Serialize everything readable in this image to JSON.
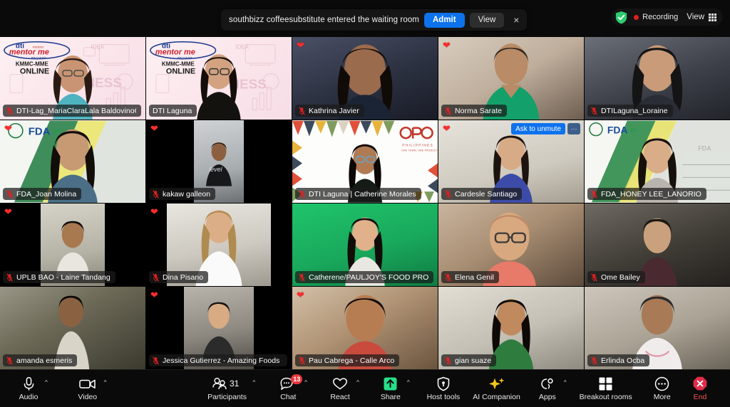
{
  "app": {
    "name": "Zoom Meeting",
    "view_mode": "Gallery View"
  },
  "top_bar": {
    "waiting_room_toast": {
      "message": "southbizz coffeesubstitute entered the waiting room",
      "admit_label": "Admit",
      "view_label": "View",
      "close_label": "×",
      "admit_color": "#0e72ed"
    },
    "encryption_icon": "shield-check-icon",
    "recording": {
      "label": "Recording",
      "dot_color": "#e02020",
      "active": true
    },
    "view_button": {
      "label": "View",
      "icon": "grid-icon"
    }
  },
  "gallery": {
    "columns": 5,
    "rows": 4,
    "active_speaker_color": "#26d07c",
    "reaction_emoji": "❤",
    "tiles": [
      {
        "name": "DTI-Lag_MariaClaraLala BaldovinoConopio",
        "muted": true,
        "reaction": false,
        "active": false,
        "bg": "dti-mentor-me"
      },
      {
        "name": "DTI Laguna",
        "muted": true,
        "reaction": false,
        "active": true,
        "bg": "dti-mentor-me"
      },
      {
        "name": "Kathrina Javier",
        "muted": true,
        "reaction": true,
        "active": false,
        "bg": "room-dark"
      },
      {
        "name": "Norma Sarate",
        "muted": true,
        "reaction": true,
        "active": false,
        "bg": "room-warm"
      },
      {
        "name": "DTILaguna_Loraine",
        "muted": true,
        "reaction": false,
        "active": false,
        "bg": "room-dim"
      },
      {
        "name": "FDA_Joan Molina",
        "muted": true,
        "reaction": true,
        "active": false,
        "bg": "fda-green"
      },
      {
        "name": "kakaw galleon",
        "muted": true,
        "reaction": true,
        "active": false,
        "bg": "black-letterbox"
      },
      {
        "name": "DTI Laguna | Catherine Morales",
        "muted": true,
        "reaction": false,
        "active": false,
        "bg": "otop-philippines"
      },
      {
        "name": "Cardesle Santiago",
        "muted": true,
        "reaction": true,
        "active": false,
        "bg": "room-plain",
        "ask_to_unmute": true
      },
      {
        "name": "FDA_HONEY LEE_LANORIO",
        "muted": true,
        "reaction": false,
        "active": false,
        "bg": "fda-green"
      },
      {
        "name": "UPLB BAO - Laine Tandang",
        "muted": true,
        "reaction": true,
        "active": false,
        "bg": "black-letterbox"
      },
      {
        "name": "Dina Pisano",
        "muted": true,
        "reaction": true,
        "active": false,
        "bg": "black-letterbox"
      },
      {
        "name": "Catherene/PAULJOY'S FOOD PRODUCTS",
        "muted": true,
        "reaction": false,
        "active": false,
        "bg": "green-screen"
      },
      {
        "name": "Elena Genil",
        "muted": true,
        "reaction": false,
        "active": false,
        "bg": "room-warm"
      },
      {
        "name": "Ome Bailey",
        "muted": true,
        "reaction": false,
        "active": false,
        "bg": "room-dim"
      },
      {
        "name": "amanda esmeris",
        "muted": true,
        "reaction": false,
        "active": false,
        "bg": "outdoor"
      },
      {
        "name": "Jessica Gutierrez - Amazing Foods Corp",
        "muted": true,
        "reaction": true,
        "active": false,
        "bg": "black-letterbox"
      },
      {
        "name": "Pau Cabrega - Calle Arco",
        "muted": true,
        "reaction": true,
        "active": false,
        "bg": "room-warm"
      },
      {
        "name": "gian suaze",
        "muted": true,
        "reaction": false,
        "active": false,
        "bg": "room-plain"
      },
      {
        "name": "Erlinda Ocba",
        "muted": true,
        "reaction": false,
        "active": false,
        "bg": "room-plain"
      }
    ],
    "ask_to_unmute": {
      "label": "Ask to unmute",
      "more_label": "⋯"
    }
  },
  "toolbar": {
    "items": [
      {
        "id": "audio",
        "label": "Audio",
        "icon": "microphone-icon",
        "caret": true
      },
      {
        "id": "video",
        "label": "Video",
        "icon": "camera-icon",
        "caret": true
      },
      {
        "id": "participants",
        "label": "Participants",
        "icon": "people-icon",
        "caret": true,
        "count": "31"
      },
      {
        "id": "chat",
        "label": "Chat",
        "icon": "chat-bubble-icon",
        "caret": true,
        "badge": "13"
      },
      {
        "id": "react",
        "label": "React",
        "icon": "heart-icon",
        "caret": true
      },
      {
        "id": "share",
        "label": "Share",
        "icon": "share-arrow-icon",
        "caret": true
      },
      {
        "id": "host-tools",
        "label": "Host tools",
        "icon": "shield-icon",
        "caret": false
      },
      {
        "id": "ai-companion",
        "label": "AI Companion",
        "icon": "sparkles-icon",
        "caret": false
      },
      {
        "id": "apps",
        "label": "Apps",
        "icon": "apps-icon",
        "caret": true
      },
      {
        "id": "breakout-rooms",
        "label": "Breakout rooms",
        "icon": "squares-icon",
        "caret": false
      },
      {
        "id": "more",
        "label": "More",
        "icon": "ellipsis-icon",
        "caret": false
      }
    ],
    "end": {
      "label": "End",
      "icon": "end-call-icon",
      "color": "#e02d4a"
    },
    "share_color": "#27e08a",
    "ai_color": "#f5c518",
    "badge_color": "#e8373d"
  }
}
